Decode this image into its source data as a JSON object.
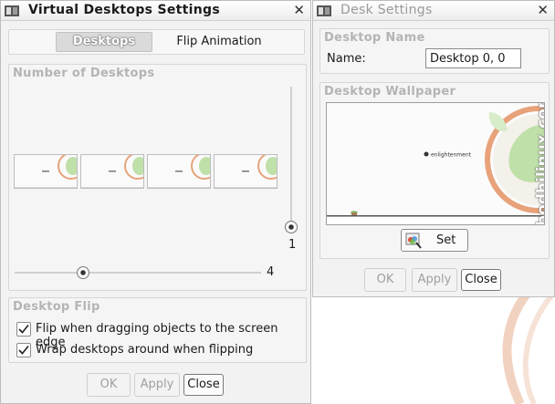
{
  "vd_window": {
    "title": "Virtual Desktops Settings",
    "tabs": [
      "Desktops",
      "Flip Animation"
    ],
    "number_frame_label": "Number of Desktops",
    "desktops_count_value": "4",
    "rows_value": "1",
    "flip_frame_label": "Desktop Flip",
    "options": [
      {
        "label": "Flip when dragging objects to the screen edge",
        "checked": true
      },
      {
        "label": "Wrap desktops around when flipping",
        "checked": true
      }
    ],
    "buttons": {
      "ok": "OK",
      "apply": "Apply",
      "close": "Close"
    }
  },
  "desk_window": {
    "title": "Desk Settings",
    "name_frame_label": "Desktop Name",
    "name_label": "Name:",
    "name_value": "Desktop 0, 0",
    "wallpaper_frame_label": "Desktop Wallpaper",
    "wallpaper_watermark": "bodhilinux.com",
    "wallpaper_caption": "enlightenment",
    "set_button": "Set",
    "buttons": {
      "ok": "OK",
      "apply": "Apply",
      "close": "Close"
    }
  },
  "colors": {
    "accent_green": "#8fc47a",
    "accent_orange": "#e8a27a"
  }
}
